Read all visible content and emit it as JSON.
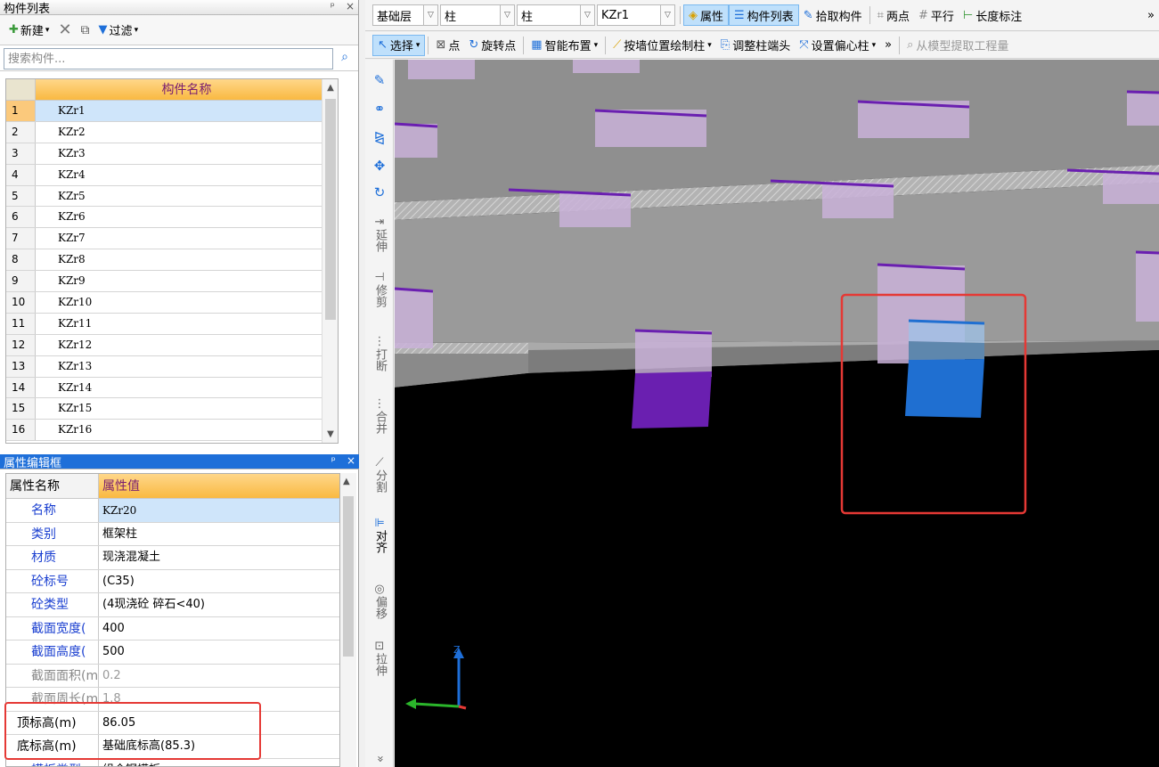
{
  "component_list": {
    "title": "构件列表",
    "ctrl_pin": "ᵖ",
    "ctrl_close": "×",
    "toolbar": {
      "new": "新建",
      "filter": "过滤"
    },
    "search_placeholder": "搜索构件...",
    "column_header": "构件名称",
    "rows": [
      {
        "n": "1",
        "name": "KZr1"
      },
      {
        "n": "2",
        "name": "KZr2"
      },
      {
        "n": "3",
        "name": "KZr3"
      },
      {
        "n": "4",
        "name": "KZr4"
      },
      {
        "n": "5",
        "name": "KZr5"
      },
      {
        "n": "6",
        "name": "KZr6"
      },
      {
        "n": "7",
        "name": "KZr7"
      },
      {
        "n": "8",
        "name": "KZr8"
      },
      {
        "n": "9",
        "name": "KZr9"
      },
      {
        "n": "10",
        "name": "KZr10"
      },
      {
        "n": "11",
        "name": "KZr11"
      },
      {
        "n": "12",
        "name": "KZr12"
      },
      {
        "n": "13",
        "name": "KZr13"
      },
      {
        "n": "14",
        "name": "KZr14"
      },
      {
        "n": "15",
        "name": "KZr15"
      },
      {
        "n": "16",
        "name": "KZr16"
      }
    ]
  },
  "property_editor": {
    "title": "属性编辑框",
    "head_name": "属性名称",
    "head_value": "属性值",
    "rows": [
      {
        "k": "名称",
        "v": "KZr20"
      },
      {
        "k": "类别",
        "v": "框架柱"
      },
      {
        "k": "材质",
        "v": "现浇混凝土"
      },
      {
        "k": "砼标号",
        "v": "(C35)"
      },
      {
        "k": "砼类型",
        "v": "(4现浇砼 碎石<40)"
      },
      {
        "k": "截面宽度(",
        "v": "400"
      },
      {
        "k": "截面高度(",
        "v": "500"
      },
      {
        "k": "截面面积(m",
        "v": "0.2"
      },
      {
        "k": "截面周长(m",
        "v": "1.8"
      },
      {
        "k": "顶标高(m)",
        "v": "86.05"
      },
      {
        "k": "底标高(m)",
        "v": "基础底标高(85.3)"
      },
      {
        "k": "模板类型",
        "v": "组合钢模板"
      }
    ]
  },
  "toolbar1": {
    "floor": "基础层",
    "type": "柱",
    "subtype": "柱",
    "component": "KZr1",
    "property": "属性",
    "component_list": "构件列表",
    "pick": "拾取构件",
    "two_point": "两点",
    "parallel": "平行",
    "length_dim": "长度标注",
    "more": "»"
  },
  "toolbar2": {
    "select": "选择",
    "point": "点",
    "rotate_point": "旋转点",
    "smart_layout": "智能布置",
    "draw_by_wall": "按墙位置绘制柱",
    "adjust_end": "调整柱端头",
    "set_eccentric": "设置偏心柱",
    "more": "»",
    "extract": "从模型提取工程量"
  },
  "vstrip": {
    "extend": "延伸",
    "trim": "修剪",
    "break": "打断",
    "merge": "合并",
    "split": "分割",
    "align": "对齐",
    "offset": "偏移",
    "stretch": "拉伸",
    "more": "»"
  },
  "axis": {
    "z_label": "Z"
  },
  "colors": {
    "accent": "#1e6fd9",
    "selected_column": "#1f6fd1",
    "column_purple": "#6a1fb0",
    "highlight": "#e53935"
  }
}
